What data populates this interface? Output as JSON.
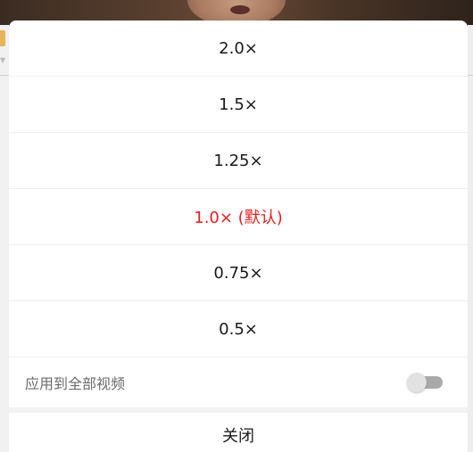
{
  "speed_sheet": {
    "options": [
      {
        "label": "2.0×",
        "selected": false
      },
      {
        "label": "1.5×",
        "selected": false
      },
      {
        "label": "1.25×",
        "selected": false
      },
      {
        "label": "1.0× (默认)",
        "selected": true
      },
      {
        "label": "0.75×",
        "selected": false
      },
      {
        "label": "0.5×",
        "selected": false
      }
    ],
    "apply_all_label": "应用到全部视频",
    "apply_all_enabled": false,
    "close_label": "关闭"
  },
  "colors": {
    "selected": "#e61e1e",
    "text": "#1a1a1a",
    "secondary_text": "#6b6b6b"
  }
}
